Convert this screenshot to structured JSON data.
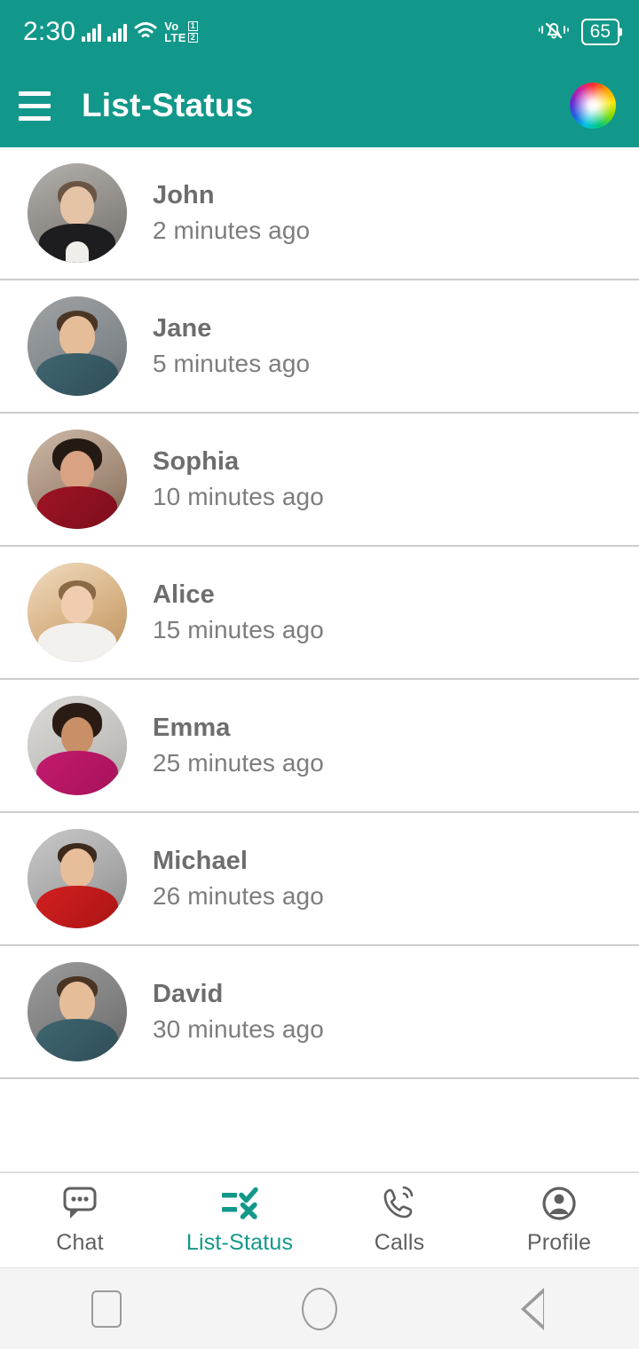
{
  "status_bar": {
    "clock": "2:30",
    "network_label_top": "Vo",
    "network_label_bottom": "LTE",
    "sim1": "1",
    "sim2": "2",
    "battery_level": "65",
    "icons": [
      "signal-icon",
      "signal-icon",
      "wifi-icon",
      "volte-icon",
      "vibrate-icon",
      "battery-icon"
    ]
  },
  "app_bar": {
    "title": "List-Status",
    "menu_icon": "hamburger-menu-icon",
    "action_icon": "color-wheel-icon"
  },
  "colors": {
    "primary": "#12988a",
    "accent": "#12988a",
    "divider": "#cdcdcd",
    "name_text": "#6d6d6d",
    "time_text": "#7d7d7d",
    "nav_inactive": "#5f5f5f",
    "nav_bg": "#ffffff",
    "android_nav_bg": "#f4f4f4"
  },
  "list": {
    "items": [
      {
        "name": "John",
        "time": "2 minutes ago",
        "avatar": "avatar-john"
      },
      {
        "name": "Jane",
        "time": "5 minutes ago",
        "avatar": "avatar-jane"
      },
      {
        "name": "Sophia",
        "time": "10 minutes ago",
        "avatar": "avatar-sophia"
      },
      {
        "name": "Alice",
        "time": "15 minutes ago",
        "avatar": "avatar-alice"
      },
      {
        "name": "Emma",
        "time": "25 minutes ago",
        "avatar": "avatar-emma"
      },
      {
        "name": "Michael",
        "time": "26 minutes ago",
        "avatar": "avatar-michael"
      },
      {
        "name": "David",
        "time": "30 minutes ago",
        "avatar": "avatar-david"
      }
    ]
  },
  "bottom_nav": {
    "items": [
      {
        "label": "Chat",
        "icon": "chat-bubble-icon",
        "active": false
      },
      {
        "label": "List-Status",
        "icon": "checklist-icon",
        "active": true
      },
      {
        "label": "Calls",
        "icon": "phone-call-icon",
        "active": false
      },
      {
        "label": "Profile",
        "icon": "person-circle-icon",
        "active": false
      }
    ]
  },
  "android_nav": {
    "recents": "recents-square-icon",
    "home": "home-circle-icon",
    "back": "back-triangle-icon"
  }
}
